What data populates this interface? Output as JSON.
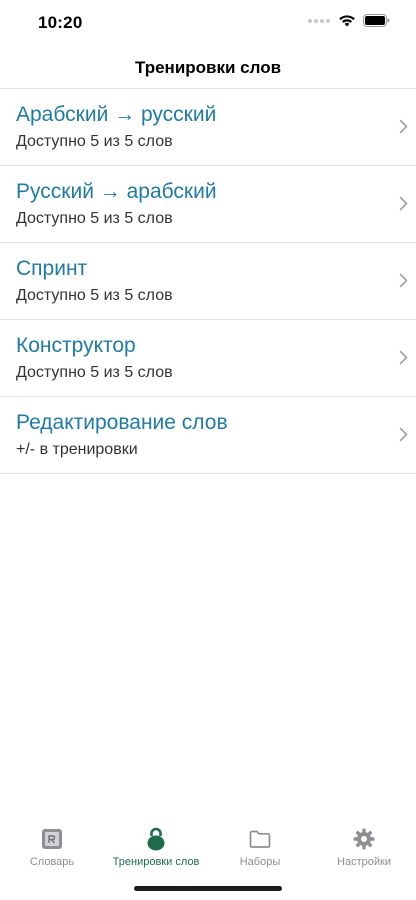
{
  "status_bar": {
    "time": "10:20"
  },
  "nav": {
    "title": "Тренировки слов"
  },
  "rows": [
    {
      "title": "Арабский → русский",
      "subtitle": "Доступно 5 из 5 слов"
    },
    {
      "title": "Русский → арабский",
      "subtitle": "Доступно 5 из 5 слов"
    },
    {
      "title": "Спринт",
      "subtitle": "Доступно 5 из 5 слов"
    },
    {
      "title": "Конструктор",
      "subtitle": "Доступно 5 из 5 слов"
    },
    {
      "title": "Редактирование слов",
      "subtitle": "+/- в тренировки"
    }
  ],
  "tabs": [
    {
      "label": "Словарь",
      "icon": "dictionary-icon",
      "active": false
    },
    {
      "label": "Тренировки слов",
      "icon": "kettlebell-icon",
      "active": true
    },
    {
      "label": "Наборы",
      "icon": "folder-icon",
      "active": false
    },
    {
      "label": "Настройки",
      "icon": "gear-icon",
      "active": false
    }
  ],
  "colors": {
    "accent": "#1f7ba6",
    "tab_active": "#1e6b4c",
    "tab_inactive": "#8e8e93",
    "separator": "#e1e1e4"
  }
}
